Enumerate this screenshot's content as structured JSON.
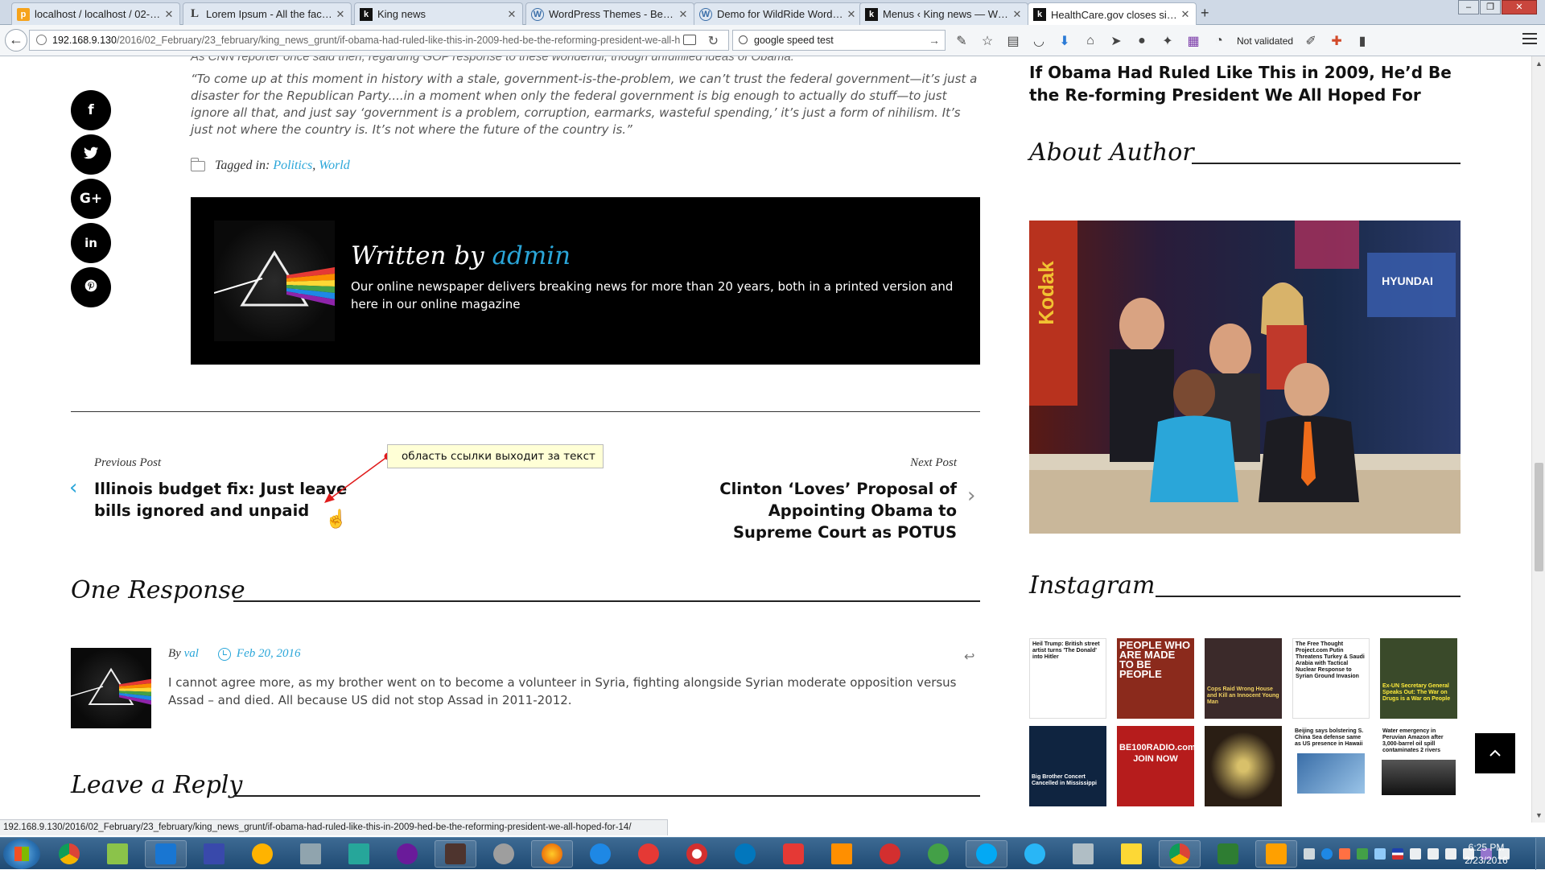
{
  "browser": {
    "tabs": [
      {
        "label": "localhost / localhost / 02-2...",
        "icon": "phpmyadmin-icon",
        "active": false
      },
      {
        "label": "Lorem Ipsum - All the facts...",
        "icon": "lorem-ipsum-icon",
        "active": false
      },
      {
        "label": "King news",
        "icon": "king-news-icon",
        "active": false
      },
      {
        "label": "WordPress Themes - Best ...",
        "icon": "wordpress-icon",
        "active": false
      },
      {
        "label": "Demo for WildRide WordPr...",
        "icon": "wordpress-icon",
        "active": false
      },
      {
        "label": "Menus ‹ King news — Wor...",
        "icon": "king-news-icon",
        "active": false
      },
      {
        "label": "HealthCare.gov closes sign...",
        "icon": "king-news-icon",
        "active": true
      }
    ],
    "url_host": "192.168.9.130",
    "url_path": "/2016/02_February/23_february/king_news_grunt/if-obama-had-ruled-like-this-in-2009-hed-be-the-reforming-president-we-all-h",
    "search_value": "google speed test",
    "not_validated_label": "Not validated",
    "status_url": "192.168.9.130/2016/02_February/23_february/king_news_grunt/if-obama-had-ruled-like-this-in-2009-hed-be-the-reforming-president-we-all-hoped-for-14/"
  },
  "article": {
    "cutline": "As CNN reporter once said then, regarding GOP response to these wonderful, though unfulfilled ideas of Obama:",
    "quote": "“To come up at this moment in history with a stale, government-is-the-problem, we can’t trust the federal government—it’s just a disaster for the Republican Party....in a moment when only the federal government is big enough to actually do stuff—to just ignore all that, and just say ‘government is a problem, corruption, earmarks, wasteful spending,’ it’s just a form of nihilism. It’s just not where the country is. It’s not where the future of the country is.”",
    "tagged_label": "Tagged in:",
    "tags": [
      "Politics",
      "World"
    ],
    "tag_sep": ", ",
    "share": [
      "f",
      "t",
      "G+",
      "in",
      "p"
    ]
  },
  "author_box": {
    "written_by": "Written by",
    "author": "admin",
    "description": "Our online newspaper delivers breaking news for more than 20 years, both in a printed version and here in our online magazine"
  },
  "post_nav": {
    "prev_label": "Previous Post",
    "prev_title": "Illinois budget fix: Just leave bills ignored and unpaid",
    "next_label": "Next Post",
    "next_title": "Clinton ‘Loves’ Proposal of Appointing Obama to Supreme Court as POTUS",
    "tooltip": "область ссылки выходит за текст"
  },
  "comments": {
    "heading": "One Response",
    "by_label": "By",
    "author": "val",
    "date": "Feb 20, 2016",
    "text": "I cannot agree more, as my brother went on to become a volunteer in Syria, fighting alongside Syrian moderate opposition versus Assad – and died. All because US did not stop Assad in 2011-2012.",
    "reply_heading": "Leave a Reply"
  },
  "sidebar": {
    "post_title": "If Obama Had Ruled Like This in 2009, He’d Be the Re-forming President We All Hoped For",
    "about_heading": "About Author",
    "instagram_heading": "Instagram",
    "instagram": [
      {
        "caption": "Heil Trump: British street artist turns 'The Donald' into Hitler",
        "bg": "#ffffff",
        "fg": "#111111"
      },
      {
        "caption": "PEOPLE WHO ARE MADE TO BE PEOPLE",
        "bg": "#8b2a1c",
        "fg": "#ffffff"
      },
      {
        "caption": "Cops Raid Wrong House and Kill an Innocent Young Man",
        "bg": "#3b2a2a",
        "fg": "#f0d060"
      },
      {
        "caption": "The Free Thought Project.com Putin Threatens Turkey & Saudi Arabia with Tactical Nuclear Response to Syrian Ground Invasion",
        "bg": "#ffffff",
        "fg": "#111111"
      },
      {
        "caption": "Ex-UN Secretary General Speaks Out: The War on Drugs is a War on People",
        "bg": "#3a4a2a",
        "fg": "#ffeb3b"
      },
      {
        "caption": "Big Brother Concert Cancelled in Mississippi",
        "bg": "#0f2440",
        "fg": "#ffffff"
      },
      {
        "caption": "BE100RADIO.com JOIN NOW",
        "bg": "#b61c1c",
        "fg": "#ffffff"
      },
      {
        "caption": "",
        "bg": "#2a1e14",
        "fg": "#ffffff"
      },
      {
        "caption": "Beijing says bolstering S. China Sea defense same as US presence in Hawaii",
        "bg": "#ffffff",
        "fg": "#111111"
      },
      {
        "caption": "Water emergency in Peruvian Amazon after 3,000-barrel oil spill contaminates 2 rivers",
        "bg": "#ffffff",
        "fg": "#111111"
      }
    ]
  },
  "taskbar": {
    "time": "6:25 PM",
    "date": "2/23/2016"
  }
}
